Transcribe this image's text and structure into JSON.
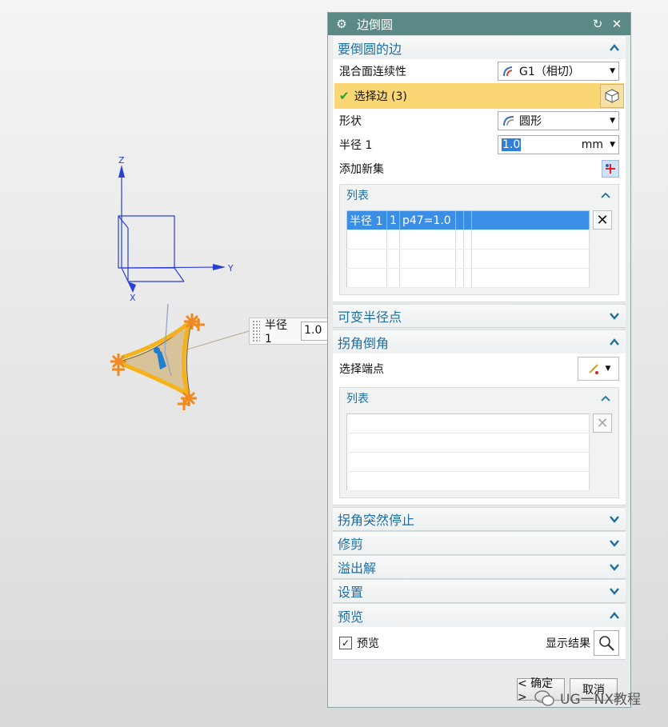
{
  "viewport": {
    "axis_labels": {
      "z": "Z",
      "y": "Y",
      "x": "X"
    },
    "callout": {
      "label": "半径 1",
      "value": "1.0"
    }
  },
  "dialog": {
    "title": "边倒圆",
    "section_edges": {
      "title": "要倒圆的边",
      "continuity_label": "混合面连续性",
      "continuity_value": "G1（相切）",
      "select_edge_label": "选择边 (3)",
      "shape_label": "形状",
      "shape_value": "圆形",
      "radius_label": "半径 1",
      "radius_value": "1.0",
      "radius_unit": "mm",
      "add_set_label": "添加新集",
      "list_title": "列表",
      "list_rows": [
        [
          "半径 1",
          "1",
          "p47=1.0",
          "",
          "",
          ""
        ],
        [
          "",
          "",
          "",
          "",
          "",
          ""
        ],
        [
          "",
          "",
          "",
          "",
          "",
          ""
        ],
        [
          "",
          "",
          "",
          "",
          "",
          ""
        ]
      ]
    },
    "section_variable": {
      "title": "可变半径点"
    },
    "section_corner": {
      "title": "拐角倒角",
      "select_endpoint_label": "选择端点",
      "list_title": "列表"
    },
    "collapsed_sections": [
      "拐角突然停止",
      "修剪",
      "溢出解",
      "设置"
    ],
    "section_preview": {
      "title": "预览",
      "preview_checkbox_label": "预览",
      "show_result_label": "显示结果"
    },
    "buttons": {
      "ok": "< 确定 >",
      "cancel": "取消"
    }
  },
  "watermark": "UG一NX教程",
  "colors": {
    "titlebar": "#5b8a86",
    "section_title": "#1d6ea5",
    "selection_highlight": "#fad674",
    "list_selected_row": "#3a8ee6",
    "fillet_orange": "#f0a040"
  }
}
